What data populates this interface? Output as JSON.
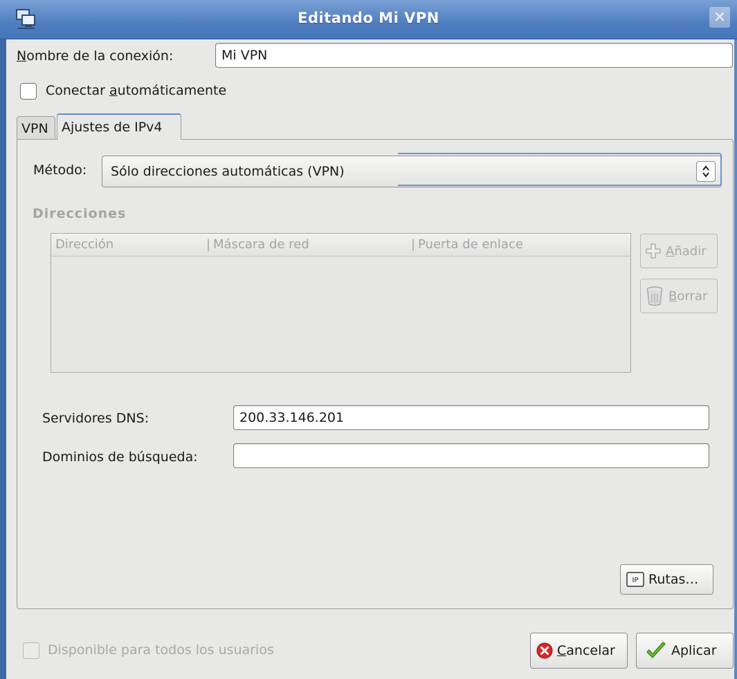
{
  "window": {
    "title": "Editando Mi VPN"
  },
  "connection": {
    "name_label_first": "N",
    "name_label_rest": "ombre de la conexión:",
    "name_value": "Mi VPN",
    "autoconnect_label_pre": "Conectar ",
    "autoconnect_label_u": "a",
    "autoconnect_label_post": "utomáticamente",
    "autoconnect_checked": false
  },
  "tabs": [
    {
      "label": "VPN",
      "active": false
    },
    {
      "label": "Ajustes de IPv4",
      "active": true
    }
  ],
  "ipv4": {
    "method_label": "Método:",
    "method_value": "Sólo direcciones automáticas (VPN)",
    "addresses_heading": "Direcciones",
    "columns": [
      "Dirección",
      "Máscara de red",
      "Puerta de enlace"
    ],
    "rows": [],
    "add_button_pre": "A",
    "add_button_post": "ñadir",
    "delete_button_pre": "B",
    "delete_button_post": "orrar",
    "dns_label": "Servidores DNS:",
    "dns_value": "200.33.146.201",
    "search_domains_label": "Dominios de búsqueda:",
    "search_domains_value": "",
    "routes_button": "Rutas…"
  },
  "footer": {
    "all_users_label": "Disponible para todos los usuarios",
    "all_users_checked": false,
    "cancel_pre": "C",
    "cancel_post": "ancelar",
    "apply_label": "Aplicar"
  },
  "icons": {
    "app": "network-connections-icon",
    "close": "close-icon",
    "cancel": "cancel-icon",
    "apply": "checkmark-icon",
    "add": "add-icon",
    "delete": "trash-icon",
    "routes": "routes-icon",
    "combo": "updown-arrows-icon"
  }
}
